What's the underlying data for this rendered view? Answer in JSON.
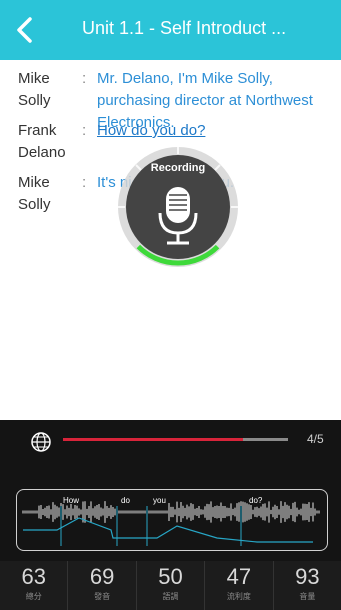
{
  "header": {
    "title": "Unit 1.1 - Self Introduct ..."
  },
  "dialog": [
    {
      "speaker": "Mike\nSolly",
      "colon": ":",
      "text": "Mr. Delano, I'm Mike Solly, purchasing director at Northwest Electronics."
    },
    {
      "speaker": "Frank\nDelano",
      "colon": ":",
      "text": "How do you do?"
    },
    {
      "speaker": "Mike\nSolly",
      "colon": ":",
      "text": "It's nice to meet you."
    }
  ],
  "recorder": {
    "label": "Recording",
    "level": 0.25
  },
  "progress": {
    "count": "4/5",
    "fraction": 0.8
  },
  "waveform": {
    "words": [
      "How",
      "do",
      "you",
      "do?"
    ]
  },
  "scores": [
    {
      "value": "63",
      "label": "總分"
    },
    {
      "value": "69",
      "label": "發音"
    },
    {
      "value": "50",
      "label": "語調"
    },
    {
      "value": "47",
      "label": "流利度"
    },
    {
      "value": "93",
      "label": "音量"
    }
  ],
  "colors": {
    "header": "#2bc4d8",
    "link": "#2d8fd6",
    "progress": "#d8243a",
    "recording": "#3ed93a"
  },
  "icons": {
    "back": "chevron-left-icon",
    "microphone": "microphone-icon",
    "language": "globe-icon"
  }
}
